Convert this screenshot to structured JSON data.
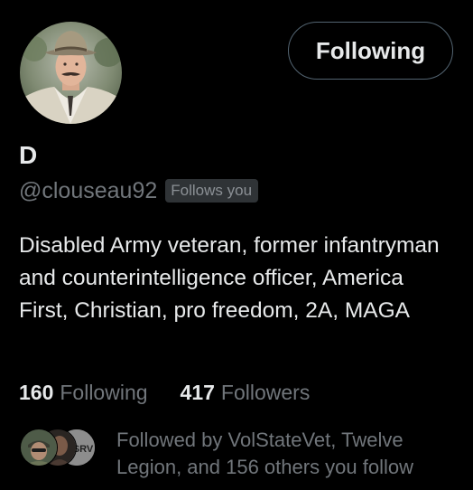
{
  "profile": {
    "display_name": "D",
    "handle": "@clouseau92",
    "follows_you_badge": "Follows you",
    "bio": "Disabled Army veteran, former infantryman and counterintelligence officer, America First, Christian, pro freedom, 2A, MAGA",
    "follow_button_label": "Following"
  },
  "stats": {
    "following_count": "160",
    "following_label": "Following",
    "followers_count": "417",
    "followers_label": "Followers"
  },
  "followed_by": {
    "text": "Followed by VolStateVet, Twelve Legion, and 156 others you follow",
    "third_avatar_initials": "SRV"
  },
  "colors": {
    "background": "#000000",
    "primary_text": "#e7e9ea",
    "secondary_text": "#71767b",
    "button_border": "#536471",
    "badge_background": "#2f3336"
  }
}
